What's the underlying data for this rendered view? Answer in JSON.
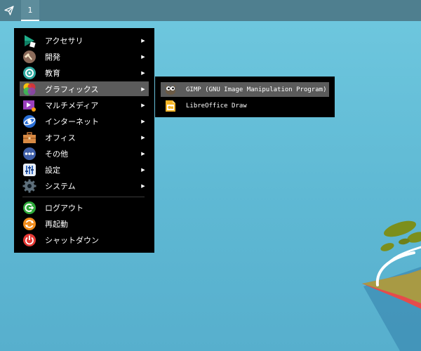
{
  "panel": {
    "launcher_icon": "paper-plane-icon",
    "workspace": "1"
  },
  "menu": {
    "items": [
      {
        "label": "アクセサリ",
        "icon": "accessories-icon",
        "has_submenu": true
      },
      {
        "label": "開発",
        "icon": "development-icon",
        "has_submenu": true
      },
      {
        "label": "教育",
        "icon": "education-icon",
        "has_submenu": true
      },
      {
        "label": "グラフィックス",
        "icon": "graphics-icon",
        "has_submenu": true,
        "active": true
      },
      {
        "label": "マルチメディア",
        "icon": "multimedia-icon",
        "has_submenu": true
      },
      {
        "label": "インターネット",
        "icon": "internet-icon",
        "has_submenu": true
      },
      {
        "label": "オフィス",
        "icon": "office-icon",
        "has_submenu": true
      },
      {
        "label": "その他",
        "icon": "other-icon",
        "has_submenu": true
      },
      {
        "label": "設定",
        "icon": "settings-icon",
        "has_submenu": true
      },
      {
        "label": "システム",
        "icon": "system-icon",
        "has_submenu": true
      }
    ],
    "actions": [
      {
        "label": "ログアウト",
        "icon": "logout-icon"
      },
      {
        "label": "再起動",
        "icon": "restart-icon"
      },
      {
        "label": "シャットダウン",
        "icon": "shutdown-icon"
      }
    ],
    "arrow": "▶"
  },
  "submenu": {
    "items": [
      {
        "label": "GIMP (GNU Image Manipulation Program)",
        "icon": "gimp-icon",
        "active": true
      },
      {
        "label": "LibreOffice Draw",
        "icon": "libreoffice-draw-icon"
      }
    ]
  },
  "colors": {
    "menu_bg": "#000000",
    "highlight": "#5b5b5b",
    "panel": "#4f7f8f",
    "desktop": "#62bdd6"
  }
}
